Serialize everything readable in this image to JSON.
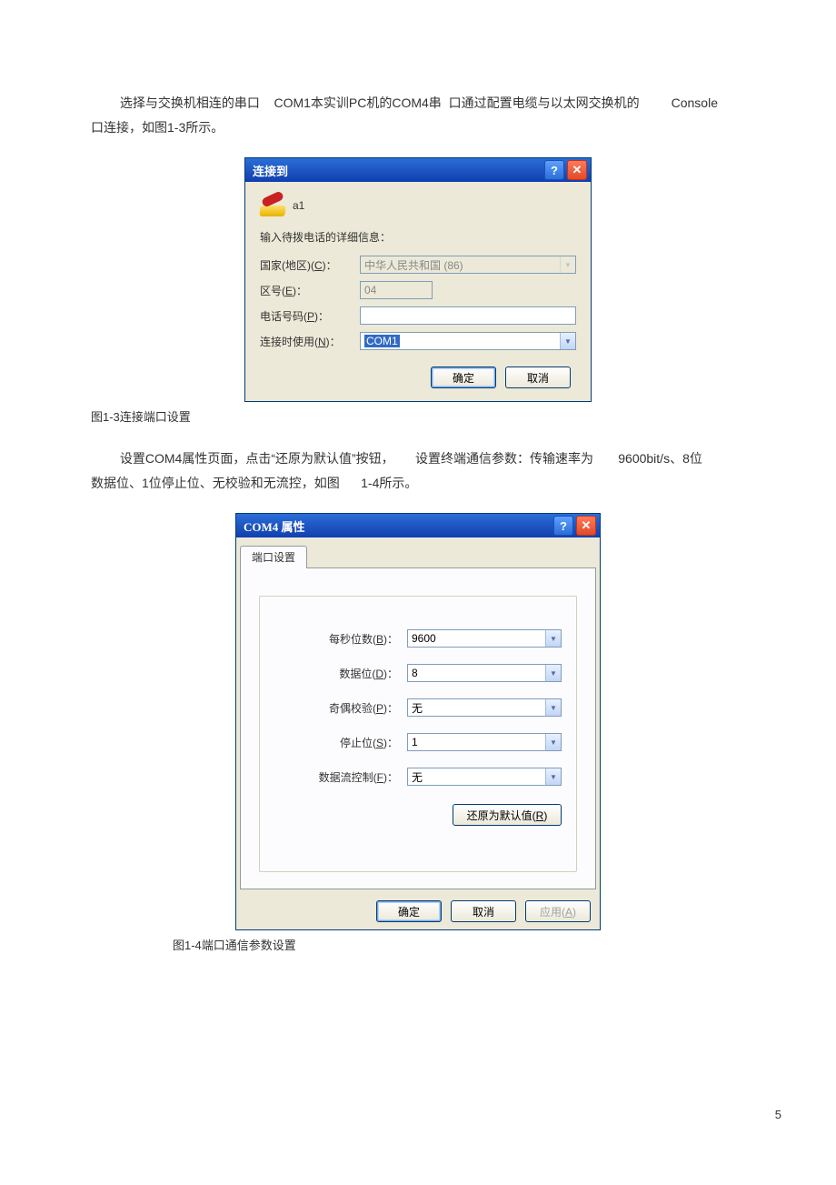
{
  "text": {
    "para1_a": "选择与交换机相连的串口",
    "para1_b": "COM1本实训PC机的COM4串",
    "para1_c": "口通过配置电缆与以太网交换机的",
    "para1_d": "Console",
    "para1_e": "口连接，如图1-3所示。",
    "caption1": "图1-3连接端口设置",
    "para2_a": "设置COM4属性页面，点击“还原为默认值”按钮，",
    "para2_b": "设置终端通信参数：传输速率为",
    "para2_c": "9600bit/s、8位",
    "para2_d": "数据位、1位停止位、无校验和无流控，如图",
    "para2_e": "1-4所示。",
    "caption2": "图1-4端口通信参数设置",
    "page_num": "5"
  },
  "dlg1": {
    "title": "连接到",
    "help": "?",
    "close": "✕",
    "conn_name": "a1",
    "prompt": "输入待拨电话的详细信息：",
    "country_label": "国家(地区)(C)：",
    "country_value": "中华人民共和国 (86)",
    "area_label": "区号(E)：",
    "area_value": "04",
    "phone_label": "电话号码(P)：",
    "phone_value": "",
    "connect_label": "连接时使用(N)：",
    "connect_value": "COM1",
    "ok": "确定",
    "cancel": "取消"
  },
  "dlg2": {
    "title": "COM4 属性",
    "help": "?",
    "close": "✕",
    "tab": "端口设置",
    "bps_label": "每秒位数(B)：",
    "bps_value": "9600",
    "data_label": "数据位(D)：",
    "data_value": "8",
    "parity_label": "奇偶校验(P)：",
    "parity_value": "无",
    "stop_label": "停止位(S)：",
    "stop_value": "1",
    "flow_label": "数据流控制(F)：",
    "flow_value": "无",
    "restore": "还原为默认值(R)",
    "ok": "确定",
    "cancel": "取消",
    "apply": "应用(A)"
  }
}
